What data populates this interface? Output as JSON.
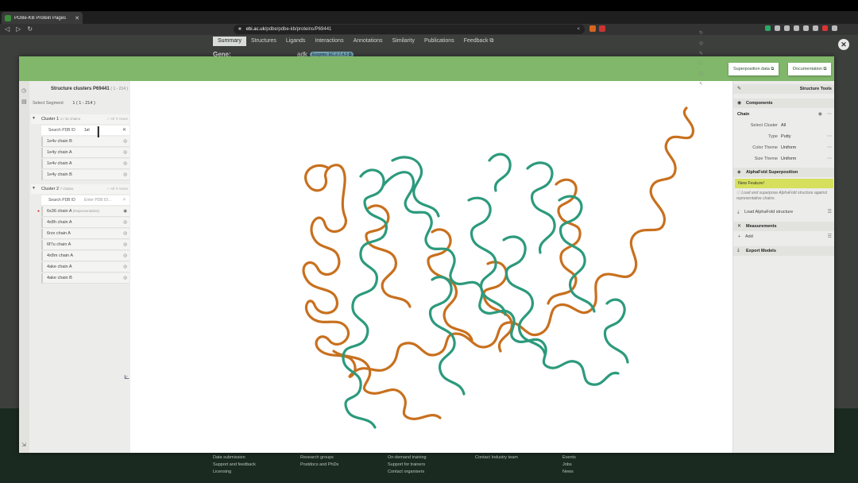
{
  "browser": {
    "tab_title": "PDBe-KB Protein Pages",
    "url_host": "ebi.ac.uk",
    "url_path": "/pdbe/pdbe-kb/proteins/P69441"
  },
  "background_page": {
    "nav": [
      "Summary",
      "Structures",
      "Ligands",
      "Interactions",
      "Annotations",
      "Similarity",
      "Publications",
      "Feedback ⧉"
    ],
    "gene_label": "Gene:",
    "gene_value": "adk",
    "enzyme_badge": "Enzyme: EC 2.7.4.3 ⧉",
    "footer_col1": [
      "Data submission",
      "Support and feedback",
      "Licensing"
    ],
    "footer_col2": [
      "Research groups",
      "Postdocs and PhDs"
    ],
    "footer_col3": [
      "On-demand training",
      "Support for trainers",
      "Contact organisers"
    ],
    "footer_col4": [
      "Contact Industry team"
    ],
    "footer_col5": [
      "Events",
      "Jobs",
      "News"
    ]
  },
  "modal": {
    "superposition_btn": "Superposition data ⧉",
    "documentation_btn": "Documentation ⧉"
  },
  "left_panel": {
    "title": "Structure clusters P69441",
    "title_range": "( 1 - 214 )",
    "segment_label": "Select Segment",
    "segment_value": "1 ( 1 - 214 )",
    "clusters": [
      {
        "name": "Cluster 1",
        "count": "4 / 32 chains",
        "actions": "✓ All  ✕ None",
        "search_label": "Search PDB ID",
        "search_value": "1el",
        "chains": [
          {
            "label": "1e4v chain B",
            "extra": ""
          },
          {
            "label": "1e4y chain A",
            "extra": ""
          },
          {
            "label": "1e4v chain A",
            "extra": ""
          },
          {
            "label": "1e4y chain B",
            "extra": ""
          }
        ]
      },
      {
        "name": "Cluster 2",
        "count": "7 chains",
        "actions": "✓ All  ✕ None",
        "search_label": "Search PDB ID",
        "search_value": "Enter PDB ID...",
        "chains": [
          {
            "label": "6s36 chain A",
            "extra": "(Representative)"
          },
          {
            "label": "4x8h chain A",
            "extra": ""
          },
          {
            "label": "6rzx chain A",
            "extra": ""
          },
          {
            "label": "6f7u chain A",
            "extra": ""
          },
          {
            "label": "4x8m chain A",
            "extra": ""
          },
          {
            "label": "4ake chain A",
            "extra": ""
          },
          {
            "label": "4ake chain B",
            "extra": ""
          }
        ]
      }
    ]
  },
  "right_panel": {
    "title": "Structure Tools",
    "components": "Components",
    "chain": "Chain",
    "rows": [
      {
        "label": "Select Cluster",
        "value": "All"
      },
      {
        "label": "Type",
        "value": "Putty"
      },
      {
        "label": "Color Theme",
        "value": "Uniform"
      },
      {
        "label": "Size Theme",
        "value": "Uniform"
      }
    ],
    "alphafold_header": "AlphaFold Superposition",
    "new_feature": "New Feature!",
    "alphafold_note": "Load and superpose AlphaFold structure against representative chains.",
    "load_af": "Load AlphaFold structure",
    "measurements": "Measurements",
    "add": "Add",
    "export_models": "Export Models"
  },
  "colors": {
    "header_green": "#80b76a",
    "orange_chain": "#c8701e",
    "teal_chain": "#2c9a7c",
    "new_feature_yellow": "#d6e05c"
  }
}
